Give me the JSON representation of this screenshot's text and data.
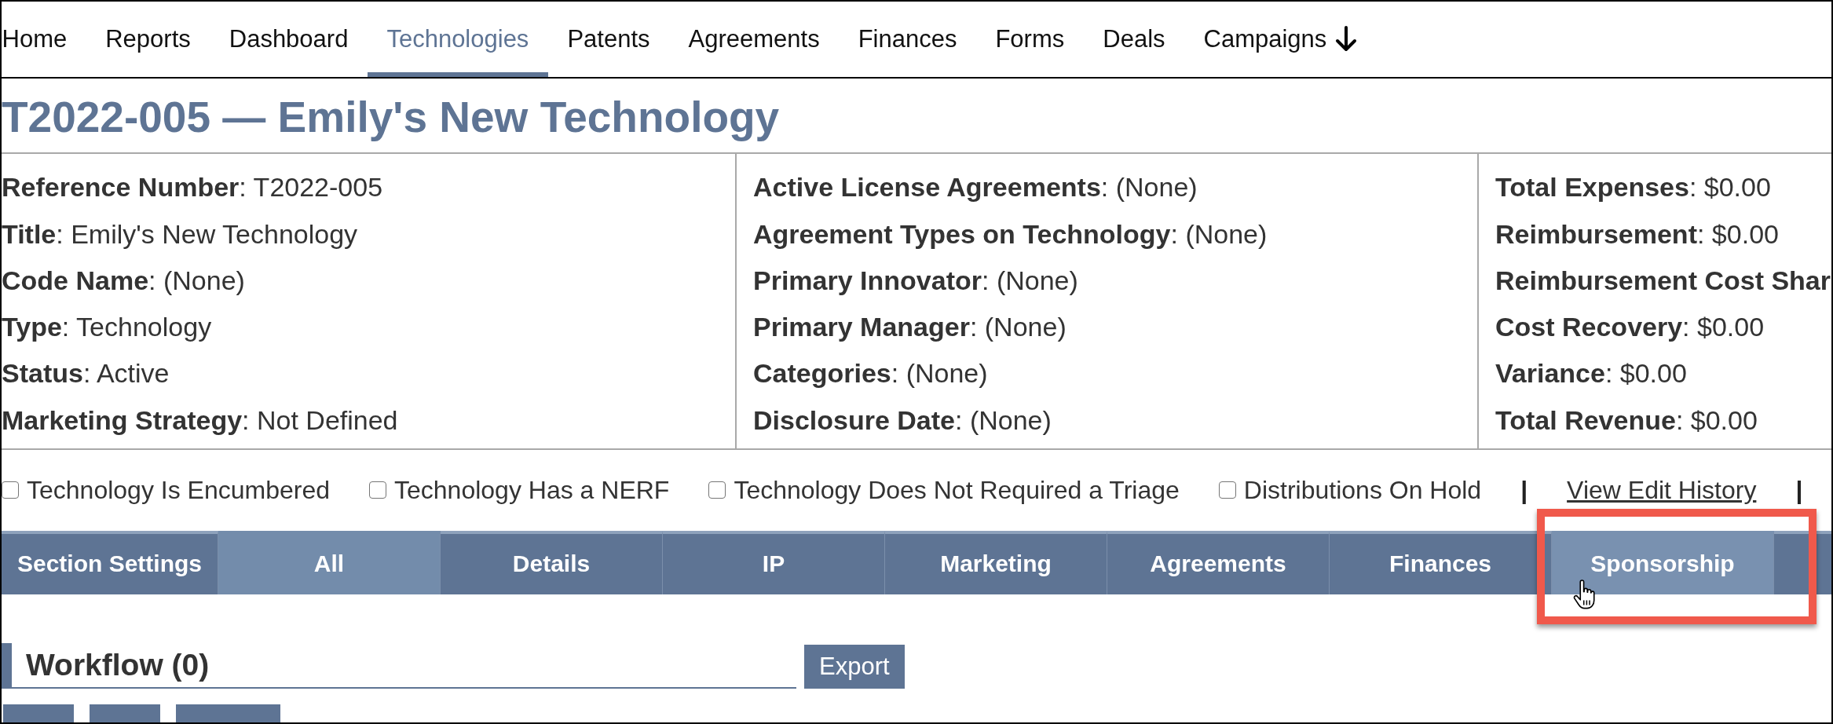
{
  "nav": {
    "items": [
      {
        "label": "Home",
        "selected": false
      },
      {
        "label": "Reports",
        "selected": false
      },
      {
        "label": "Dashboard",
        "selected": false
      },
      {
        "label": "Technologies",
        "selected": true
      },
      {
        "label": "Patents",
        "selected": false
      },
      {
        "label": "Agreements",
        "selected": false
      },
      {
        "label": "Finances",
        "selected": false
      },
      {
        "label": "Forms",
        "selected": false
      },
      {
        "label": "Deals",
        "selected": false
      },
      {
        "label": "Campaigns",
        "selected": false
      }
    ]
  },
  "title": "T2022-005 — Emily's New Technology",
  "info_columns": [
    {
      "rows": [
        "**Reference Number**: T2022-005",
        "**Title**: Emily's New Technology",
        "**Code Name**: (None)",
        "**Type**: Technology",
        "**Status**: Active",
        "**Marketing Strategy**: Not Defined"
      ]
    },
    {
      "rows": [
        "**Active License Agreements**: (None)",
        "**Agreement Types on Technology**: (None)",
        "**Primary Innovator**: (None)",
        "**Primary Manager**: (None)",
        "**Categories**: (None)",
        "**Disclosure Date**: (None)"
      ]
    },
    {
      "rows": [
        "**Total Expenses**: $0.00",
        "**Reimbursement**: $0.00",
        "**Reimbursement Cost Shar**",
        "**Cost Recovery**: $0.00",
        "**Variance**: $0.00",
        "**Total Revenue**: $0.00"
      ]
    }
  ],
  "flags": [
    {
      "label": "Technology Is Encumbered",
      "checked": false
    },
    {
      "label": "Technology Has a NERF",
      "checked": false
    },
    {
      "label": "Technology Does Not Required a Triage",
      "checked": false
    },
    {
      "label": "Distributions On Hold",
      "checked": false
    }
  ],
  "history": {
    "separator_before": "|",
    "link": "View Edit History",
    "separator_after": "|"
  },
  "section_tabs": [
    {
      "label": "Section Settings",
      "selected": false,
      "hovered": false,
      "highlighted": false
    },
    {
      "label": "All",
      "selected": true,
      "hovered": false,
      "highlighted": false
    },
    {
      "label": "Details",
      "selected": false,
      "hovered": false,
      "highlighted": false
    },
    {
      "label": "IP",
      "selected": false,
      "hovered": false,
      "highlighted": false
    },
    {
      "label": "Marketing",
      "selected": false,
      "hovered": false,
      "highlighted": false
    },
    {
      "label": "Agreements",
      "selected": false,
      "hovered": false,
      "highlighted": false
    },
    {
      "label": "Finances",
      "selected": false,
      "hovered": false,
      "highlighted": false
    },
    {
      "label": "Sponsorship",
      "selected": false,
      "hovered": true,
      "highlighted": true
    }
  ],
  "workflow": {
    "title": "Workflow (0)",
    "export": "Export",
    "actions": [
      {
        "kind": "short"
      },
      {
        "kind": "short"
      },
      {
        "kind": "long"
      }
    ]
  }
}
